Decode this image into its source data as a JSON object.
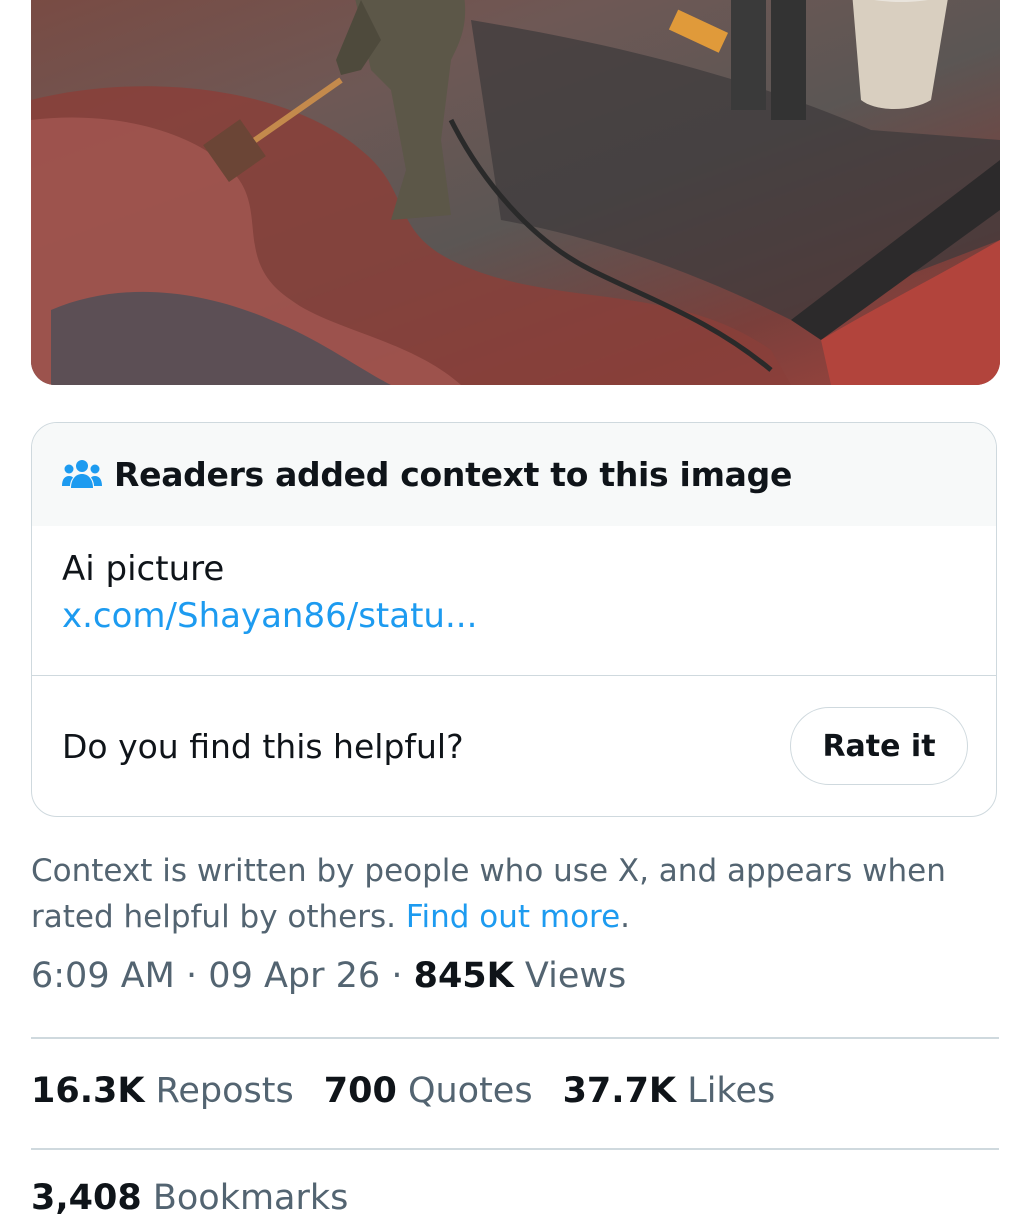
{
  "media": {
    "alt_icon": "photo"
  },
  "note": {
    "header_icon": "people-icon",
    "title": "Readers added context to this image",
    "text": "Ai picture",
    "link": "x.com/Shayan86/statu...",
    "question": "Do you find this helpful?",
    "rate_label": "Rate it"
  },
  "disclaimer": {
    "text": "Context is written by people who use X, and appears when rated helpful by others.",
    "link": "Find out more",
    "end": "."
  },
  "meta": {
    "time": "6:09 AM",
    "sep1": "·",
    "date": "09 Apr 26",
    "sep2": "·",
    "views_count": "845K",
    "views_label": "Views"
  },
  "stats": {
    "reposts_count": "16.3K",
    "reposts_label": "Reposts",
    "quotes_count": "700",
    "quotes_label": "Quotes",
    "likes_count": "37.7K",
    "likes_label": "Likes"
  },
  "cutoff": {
    "count": "3,408",
    "label": "Bookmarks"
  },
  "colors": {
    "accent": "#1d9bf0",
    "secondary_text": "#536471",
    "border": "#cfd9de"
  }
}
